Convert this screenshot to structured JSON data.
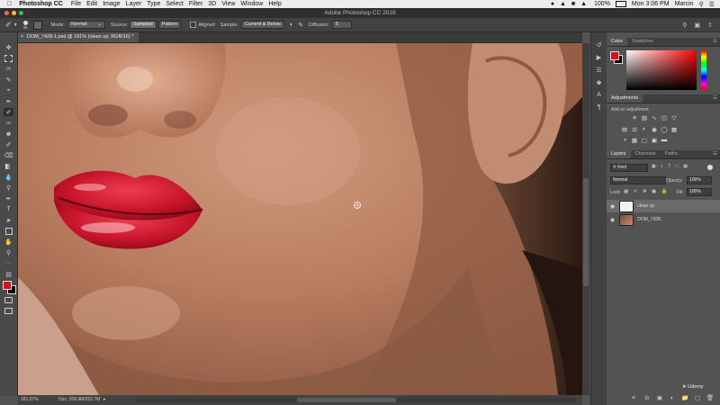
{
  "menubar": {
    "apple_icon": "apple-icon",
    "app_name": "Photoshop CC",
    "items": [
      "File",
      "Edit",
      "Image",
      "Layer",
      "Type",
      "Select",
      "Filter",
      "3D",
      "View",
      "Window",
      "Help"
    ],
    "battery": "100%",
    "clock": "Mon 3:06 PM",
    "user": "Marcin"
  },
  "window": {
    "title": "Adobe Photoshop CC 2018"
  },
  "options": {
    "brush_size": "25",
    "mode_label": "Mode:",
    "mode_value": "Normal",
    "source_label": "Source:",
    "source_sampled": "Sampled",
    "source_pattern": "Pattern",
    "aligned_label": "Aligned",
    "sample_label": "Sample:",
    "sample_value": "Current & Below",
    "diffusion_label": "Diffusion:",
    "diffusion_value": "5"
  },
  "document": {
    "tab_title": "DOM_7428-1.psd @ 181% (clean up, RGB/16) *",
    "zoom": "181.07%",
    "doc_info": "Doc: 209.9M/252.7M"
  },
  "panels": {
    "color_tabs": [
      "Color",
      "Swatches"
    ],
    "adjustments_tab": "Adjustments",
    "add_adjustment": "Add an adjustment",
    "layers_tabs": [
      "Layers",
      "Channels",
      "Paths"
    ],
    "kind_value": "Kind",
    "blend_mode": "Normal",
    "opacity_label": "Opacity:",
    "opacity_value": "100%",
    "lock_label": "Lock:",
    "fill_label": "Fill:",
    "fill_value": "100%",
    "layers": [
      {
        "name": "clean up"
      },
      {
        "name": "DOM_7428"
      }
    ]
  },
  "watermark": "Udemy",
  "colors": {
    "foreground": "#d8101c",
    "background": "#000000",
    "lip": "#c5142a"
  }
}
